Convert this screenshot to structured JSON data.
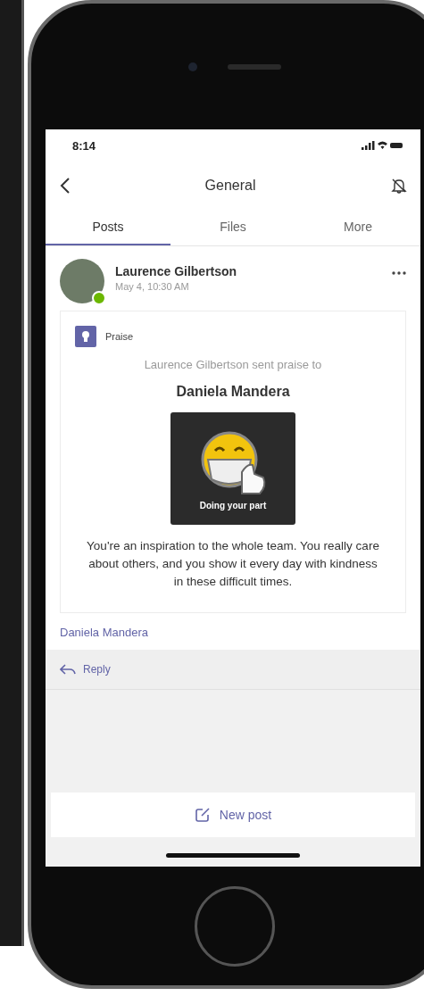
{
  "status_bar": {
    "time": "8:14"
  },
  "header": {
    "title": "General"
  },
  "tabs": [
    {
      "label": "Posts",
      "selected": true
    },
    {
      "label": "Files",
      "selected": false
    },
    {
      "label": "More",
      "selected": false
    }
  ],
  "post": {
    "author": "Laurence Gilbertson",
    "timestamp": "May 4, 10:30 AM",
    "online": true,
    "card": {
      "label": "Praise",
      "intro": "Laurence Gilbertson sent praise to",
      "recipient": "Daniela Mandera",
      "badge_caption": "Doing your part",
      "message": "You're an inspiration to the whole team. You really care about others, and you show it every day with kindness in these difficult times."
    },
    "mention": "Daniela Mandera",
    "reply": "Reply"
  },
  "new_post": {
    "label": "New post"
  }
}
